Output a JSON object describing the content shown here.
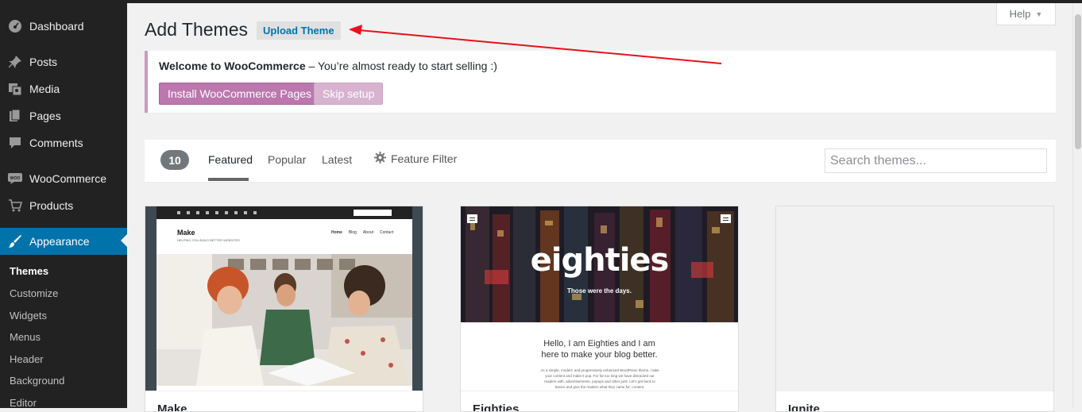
{
  "sidebar": {
    "items": [
      {
        "label": "Dashboard",
        "icon": "dashboard-icon"
      },
      {
        "label": "Posts",
        "icon": "pin-icon"
      },
      {
        "label": "Media",
        "icon": "media-icon"
      },
      {
        "label": "Pages",
        "icon": "pages-icon"
      },
      {
        "label": "Comments",
        "icon": "comment-icon"
      },
      {
        "label": "WooCommerce",
        "icon": "woo-icon"
      },
      {
        "label": "Products",
        "icon": "cart-icon"
      },
      {
        "label": "Appearance",
        "icon": "brush-icon"
      }
    ],
    "submenu": [
      "Themes",
      "Customize",
      "Widgets",
      "Menus",
      "Header",
      "Background",
      "Editor"
    ]
  },
  "header": {
    "title": "Add Themes",
    "upload_label": "Upload Theme",
    "help_label": "Help"
  },
  "notice": {
    "title": "Welcome to WooCommerce",
    "text": " – You’re almost ready to start selling :)",
    "install_label": "Install WooCommerce Pages",
    "skip_label": "Skip setup"
  },
  "filter": {
    "count": "10",
    "tabs": [
      "Featured",
      "Popular",
      "Latest"
    ],
    "feature_filter_label": "Feature Filter",
    "search_placeholder": "Search themes..."
  },
  "themes": [
    {
      "name": "Make",
      "preview": {
        "logo": "Make",
        "tagline": "HELPING YOU BUILD BETTER WEBSITES",
        "nav": [
          "Home",
          "Blog",
          "About",
          "Contact"
        ]
      }
    },
    {
      "name": "Eighties",
      "preview": {
        "title": "eighties",
        "subtitle": "Those were the days.",
        "hello": "Hello, I am Eighties and I am here to make your blog better.",
        "body": "As a simple, modern and progressively enhanced WordPress theme, I take your content and make it pop. For far too long we have distracted our readers with, advertisements, popups and other junk. Let's get back to basics and give the readers what they came for: content."
      }
    },
    {
      "name": "Ignite"
    }
  ],
  "colors": {
    "sidebar_bg": "#222222",
    "accent": "#0073aa",
    "woo_purple": "#bb77ae",
    "annotation_red": "#e8101a"
  }
}
